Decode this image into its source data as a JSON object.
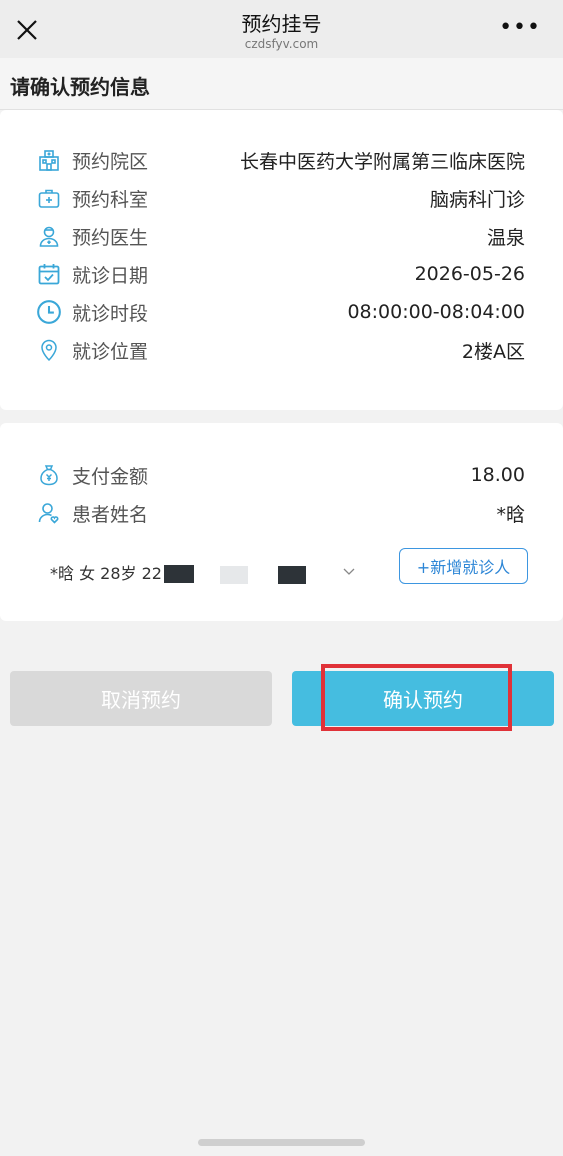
{
  "nav": {
    "title": "预约挂号",
    "domain": "czdsfyv.com",
    "more": "•••"
  },
  "header": {
    "title": "请确认预约信息"
  },
  "appointment": [
    {
      "icon": "hospital-icon",
      "label": "预约院区",
      "value": "长春中医药大学附属第三临床医院"
    },
    {
      "icon": "medical-kit-icon",
      "label": "预约科室",
      "value": "脑病科门诊"
    },
    {
      "icon": "doctor-icon",
      "label": "预约医生",
      "value": "温泉"
    },
    {
      "icon": "calendar-icon",
      "label": "就诊日期",
      "value": "2026-05-26"
    },
    {
      "icon": "clock-icon",
      "label": "就诊时段",
      "value": "08:00:00-08:04:00"
    },
    {
      "icon": "location-pin-icon",
      "label": "就诊位置",
      "value": "2楼A区"
    }
  ],
  "payment": [
    {
      "icon": "money-bag-icon",
      "label": "支付金额",
      "value": "18.00"
    },
    {
      "icon": "patient-icon",
      "label": "患者姓名",
      "value": "*晗"
    }
  ],
  "patient_select": {
    "text": "*晗 女 28岁 22"
  },
  "add_patient_label": "+新增就诊人",
  "buttons": {
    "cancel": "取消预约",
    "confirm": "确认预约"
  },
  "colors": {
    "accent": "#45bde0",
    "icon": "#3aa7d8",
    "link": "#2d86d6",
    "highlight": "#e03238",
    "cancel": "#d9d9d9"
  }
}
